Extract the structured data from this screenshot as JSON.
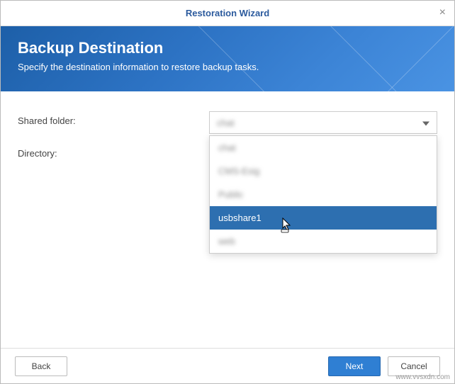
{
  "window": {
    "title": "Restoration Wizard"
  },
  "banner": {
    "heading": "Backup Destination",
    "subtitle": "Specify the destination information to restore backup tasks."
  },
  "form": {
    "shared_folder_label": "Shared folder:",
    "directory_label": "Directory:",
    "shared_folder_value": "chat",
    "dropdown": {
      "items": [
        {
          "label": "chat",
          "blurred": true
        },
        {
          "label": "CMS-Esig",
          "blurred": true
        },
        {
          "label": "Public",
          "blurred": true
        },
        {
          "label": "usbshare1",
          "blurred": false,
          "highlighted": true
        },
        {
          "label": "web",
          "blurred": true
        }
      ]
    }
  },
  "footer": {
    "back": "Back",
    "next": "Next",
    "cancel": "Cancel"
  },
  "watermark": "www.vvsxdn.com"
}
